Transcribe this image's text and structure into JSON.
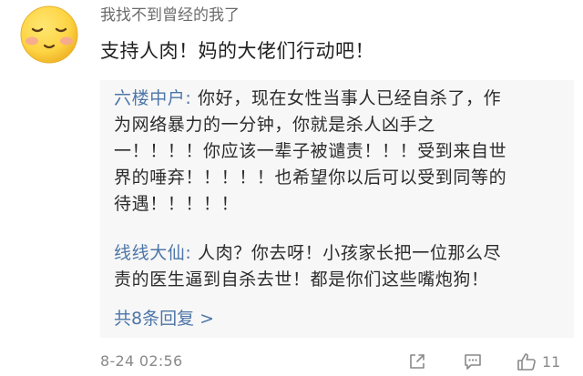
{
  "comment": {
    "username": "我找不到曾经的我了",
    "text": "支持人肉！妈的大佬们行动吧！",
    "avatar_icon": "emoji-blush-face",
    "avatar_color": "#fdd443"
  },
  "replies": [
    {
      "author": "六楼中户:",
      "lines": [
        " 你好，现在女性当事人已经自杀了，作",
        "为网络暴力的一分钟，你就是杀人凶手之",
        "一！！！！你应该一辈子被谴责！！！受到来自世",
        "界的唾弃！！！！！也希望你以后可以受到同等的",
        "待遇！！！！！"
      ]
    },
    {
      "author": "线线大仙:",
      "lines": [
        " 人肉？你去呀！小孩家长把一位那么尽",
        "责的医生逼到自杀去世！都是你们这些嘴炮狗！"
      ]
    }
  ],
  "see_all_replies": "共8条回复 >",
  "meta": {
    "timestamp": "8-24 02:56",
    "like_count": "11",
    "icons": [
      "share-icon",
      "comment-icon",
      "like-icon"
    ]
  },
  "colors": {
    "link_blue": "#4d76a8",
    "reply_background": "#f7f7f7",
    "meta_gray": "#8a8a8a"
  }
}
